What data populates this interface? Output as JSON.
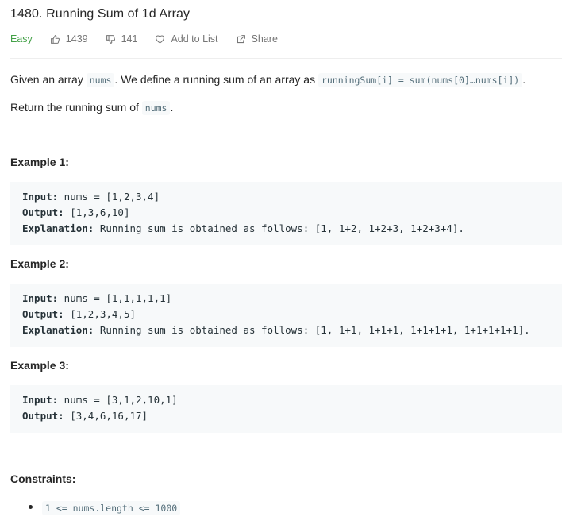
{
  "problem": {
    "title": "1480. Running Sum of 1d Array",
    "difficulty": "Easy",
    "likes": "1439",
    "dislikes": "141",
    "add_to_list": "Add to List",
    "share": "Share"
  },
  "description": {
    "p1_a": "Given an array",
    "p1_code1": "nums",
    "p1_b": ". We define a running sum of an array as",
    "p1_code2": "runningSum[i] = sum(nums[0]…nums[i])",
    "p1_c": ".",
    "p2_a": "Return the running sum of",
    "p2_code": "nums",
    "p2_b": "."
  },
  "examples": [
    {
      "heading": "Example 1:",
      "input_label": "Input:",
      "input": " nums = [1,2,3,4]",
      "output_label": "Output:",
      "output": " [1,3,6,10]",
      "explanation_label": "Explanation:",
      "explanation": " Running sum is obtained as follows: [1, 1+2, 1+2+3, 1+2+3+4]."
    },
    {
      "heading": "Example 2:",
      "input_label": "Input:",
      "input": " nums = [1,1,1,1,1]",
      "output_label": "Output:",
      "output": " [1,2,3,4,5]",
      "explanation_label": "Explanation:",
      "explanation": " Running sum is obtained as follows: [1, 1+1, 1+1+1, 1+1+1+1, 1+1+1+1+1]."
    },
    {
      "heading": "Example 3:",
      "input_label": "Input:",
      "input": " nums = [3,1,2,10,1]",
      "output_label": "Output:",
      "output": " [3,4,6,16,17]"
    }
  ],
  "constraints": {
    "heading": "Constraints:",
    "items": [
      "1 <= nums.length <= 1000"
    ]
  },
  "colors": {
    "easy": "#43a047",
    "code_bg": "#f7f9fa"
  },
  "icons": [
    "thumbs-up-icon",
    "thumbs-down-icon",
    "heart-icon",
    "share-icon"
  ]
}
